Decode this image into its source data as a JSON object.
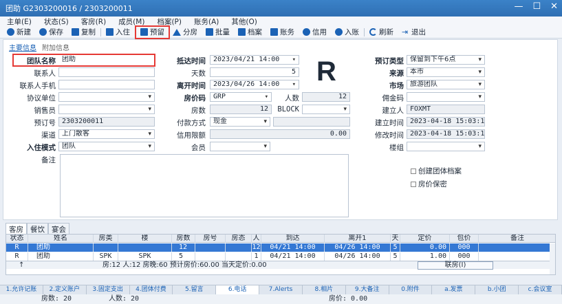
{
  "window": {
    "title": "团助 G2303200016 / 2303200011",
    "btn_min": "—",
    "btn_max": "☐",
    "btn_close": "✕"
  },
  "menu": [
    "主单(E)",
    "状态(S)",
    "客房(R)",
    "成员(M)",
    "档案(P)",
    "账务(A)",
    "其他(O)"
  ],
  "toolbar": [
    {
      "label": "新建",
      "icon": "plus-icon"
    },
    {
      "label": "保存",
      "icon": "check-icon"
    },
    {
      "label": "复制",
      "icon": "copy-icon"
    },
    {
      "label": "入住",
      "icon": "checkin-icon"
    },
    {
      "label": "预留",
      "icon": "reserve-icon",
      "highlighted": true
    },
    {
      "label": "分房",
      "icon": "house-icon"
    },
    {
      "label": "批量",
      "icon": "grid-icon"
    },
    {
      "label": "档案",
      "icon": "profile-icon"
    },
    {
      "label": "账务",
      "icon": "account-icon"
    },
    {
      "label": "信用",
      "icon": "shield-icon"
    },
    {
      "label": "入账",
      "icon": "post-icon"
    },
    {
      "label": "刷新",
      "icon": "refresh-icon"
    },
    {
      "label": "退出",
      "icon": "exit-icon"
    }
  ],
  "form_tabs": {
    "main": "主要信息",
    "extra": "附加信息"
  },
  "fields": {
    "team_name": {
      "label": "团队名称",
      "value": "团助"
    },
    "contact": {
      "label": "联系人",
      "value": ""
    },
    "contact_phone": {
      "label": "联系人手机",
      "value": ""
    },
    "agreement": {
      "label": "协议单位",
      "value": ""
    },
    "salesperson": {
      "label": "销售员",
      "value": ""
    },
    "booking_no": {
      "label": "预订号",
      "value": "2303200011"
    },
    "channel": {
      "label": "渠道",
      "value": "上门散客"
    },
    "checkin_mode": {
      "label": "入住模式",
      "value": "团队"
    },
    "remarks": {
      "label": "备注",
      "value": ""
    },
    "arrival": {
      "label": "抵达时间",
      "value": "2023/04/21 14:00"
    },
    "days": {
      "label": "天数",
      "value": "5"
    },
    "departure": {
      "label": "离开时间",
      "value": "2023/04/26 14:00"
    },
    "rate_code": {
      "label": "房价码",
      "value": "GRP"
    },
    "persons": {
      "label": "人数",
      "value": "12"
    },
    "rooms": {
      "label": "房数",
      "value": "12"
    },
    "block": {
      "label": "BLOCK",
      "value": ""
    },
    "payment": {
      "label": "付款方式",
      "value": "现金"
    },
    "payment_extra": {
      "value": ""
    },
    "credit_limit": {
      "label": "信用限额",
      "value": "0.00"
    },
    "member": {
      "label": "会员",
      "value": ""
    },
    "status_letter": "R",
    "reserve_type": {
      "label": "预订类型",
      "value": "保留到下午6点"
    },
    "source": {
      "label": "来源",
      "value": "本市"
    },
    "market": {
      "label": "市场",
      "value": "旅游团队"
    },
    "commission": {
      "label": "佣金码",
      "value": ""
    },
    "creator": {
      "label": "建立人",
      "value": "FOXMT"
    },
    "created_at": {
      "label": "建立时间",
      "value": "2023-04-18 15:03:19"
    },
    "modified_at": {
      "label": "修改时间",
      "value": "2023-04-18 15:03:19"
    },
    "building": {
      "label": "楼组",
      "value": ""
    },
    "create_profile": "创建团体档案",
    "keep_rate": "房价保密"
  },
  "bottom_tabs": [
    "客房",
    "餐饮",
    "宴会"
  ],
  "grid": {
    "headers": [
      "状态",
      "姓名",
      "房类",
      "楼",
      "房数",
      "房号",
      "房态",
      "人",
      "到达",
      "离开1",
      "天",
      "定价",
      "包价",
      "备注"
    ],
    "rows": [
      [
        "R",
        "团助",
        "",
        "",
        "12",
        "",
        "",
        "12",
        "04/21 14:00",
        "04/26 14:00",
        "5",
        "0.00",
        "000",
        ""
      ],
      [
        "R",
        "团助",
        "SPK",
        "SPK",
        "5",
        "",
        "",
        "1",
        "04/21 14:00",
        "04/26 14:00",
        "5",
        "1.00",
        "000",
        ""
      ]
    ],
    "summary": {
      "arrow": "↑",
      "text": "房:12  人:12  房晚:60  预计房价:60.00  当天定价:0.00",
      "button": "联房(I)"
    }
  },
  "func_tabs": [
    "1.允许记账",
    "2.定义账户",
    "3.固定支出",
    "4.团体付费",
    "5.留言",
    "6.电话",
    "7.Alerts",
    "8.相片",
    "9.大备注",
    "0.附件",
    "a.发票",
    "b.小团",
    "c.会议室"
  ],
  "status": {
    "rooms": "房数: 20",
    "persons": "人数: 20",
    "price": "房价: 0.00"
  }
}
